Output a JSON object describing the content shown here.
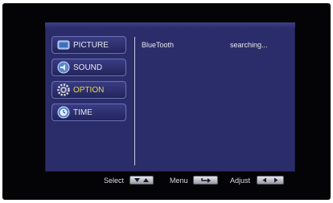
{
  "menu": {
    "tabs": [
      {
        "label": "PICTURE",
        "icon": "picture-icon",
        "selected": false
      },
      {
        "label": "SOUND",
        "icon": "sound-icon",
        "selected": false
      },
      {
        "label": "OPTION",
        "icon": "gear-icon",
        "selected": true
      },
      {
        "label": "TIME",
        "icon": "clock-icon",
        "selected": false
      }
    ],
    "selected_color": "#e6d84a"
  },
  "content": {
    "item_label": "BlueTooth",
    "item_status": "searching..."
  },
  "hints": {
    "select_label": "Select",
    "menu_label": "Menu",
    "adjust_label": "Adjust"
  }
}
